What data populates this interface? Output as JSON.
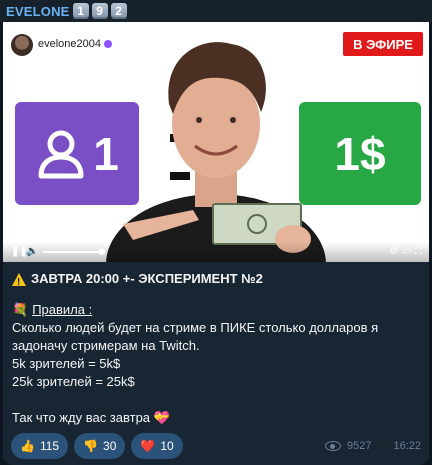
{
  "channel": {
    "name": "EVELONE",
    "number_keys": [
      "1",
      "9",
      "2"
    ]
  },
  "video": {
    "uploader": "evelone2004",
    "live_badge": "В ЭФИРЕ",
    "card_left_number": "1",
    "card_right_text": "1$",
    "colors": {
      "left_card": "#7a4fc6",
      "right_card": "#27a845",
      "live_badge": "#e01a1a"
    }
  },
  "post": {
    "headline": "ЗАВТРА 20:00 +- ЭКСПЕРИМЕНТ №2",
    "rules_label": "Правила :",
    "lines": [
      "Сколько людей будет на стриме в ПИКЕ столько долларов я",
      "задоначу стримерам на Twitch.",
      "5k зрителей = 5k$",
      "25k зрителей = 25k$"
    ],
    "closing": "Так что жду вас завтра",
    "closing_emoji": "💝"
  },
  "reactions": [
    {
      "icon": "👍",
      "icon_name": "thumbs-up-icon",
      "count": "115"
    },
    {
      "icon": "👎",
      "icon_name": "thumbs-down-icon",
      "count": "30"
    },
    {
      "icon": "❤️",
      "icon_name": "heart-icon",
      "count": "10"
    }
  ],
  "meta": {
    "views": "9527",
    "time": "16:22"
  }
}
